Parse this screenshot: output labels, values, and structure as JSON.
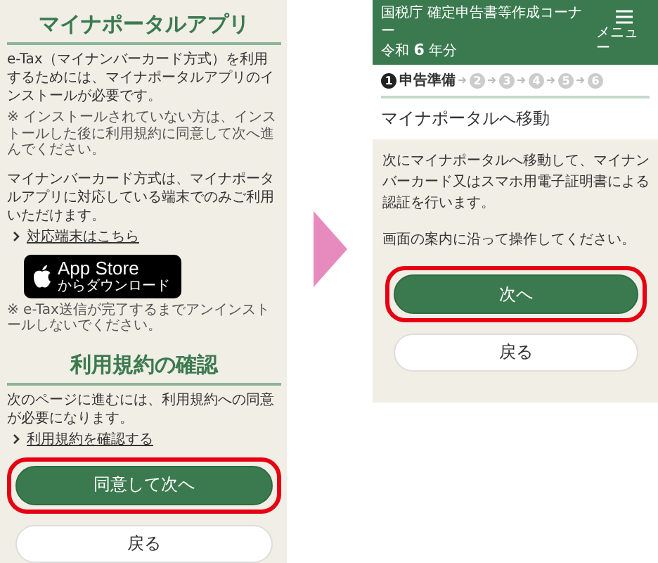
{
  "left_screen": {
    "heading": "マイナポータルアプリ",
    "intro": "e-Tax（マイナンバーカード方式）を利用するためには、マイナポータルアプリのインストールが必要です。",
    "install_note": "※ インストールされていない方は、インストールした後に利用規約に同意して次へ進んでください。",
    "support_text": "マイナンバーカード方式は、マイナポータルアプリに対応している端末でのみご利用いただけます。",
    "device_link": "対応端末はこちら",
    "app_store_badge": {
      "title": "App Store",
      "subtitle": "からダウンロード"
    },
    "uninstall_note": "※ e-Tax送信が完了するまでアンインストールしないでください。",
    "terms_heading": "利用規約の確認",
    "terms_text": "次のページに進むには、利用規約への同意が必要になります。",
    "terms_link": "利用規約を確認する",
    "buttons": [
      {
        "label": "同意して次へ",
        "kind": "primary",
        "highlighted": true
      },
      {
        "label": "戻る",
        "kind": "secondary",
        "highlighted": false
      }
    ]
  },
  "right_screen": {
    "header": {
      "title": "国税庁 確定申告書等作成コーナー",
      "year": "令和 **6** 年分",
      "menu_label": "メニュー"
    },
    "steps": [
      {
        "number": "1",
        "label": "申告準備",
        "selected": true
      },
      {
        "number": "2",
        "selected": false
      },
      {
        "number": "3",
        "selected": false
      },
      {
        "number": "4",
        "selected": false
      },
      {
        "number": "5",
        "selected": false
      },
      {
        "number": "6",
        "selected": false
      }
    ],
    "page_title": "マイナポータルへ移動",
    "paragraphs": [
      "次にマイナポータルへ移動して、マイナンバーカード又はスマホ用電子証明書による認証を行います。",
      "画面の案内に沿って操作してください。"
    ],
    "buttons": [
      {
        "label": "次へ",
        "kind": "primary",
        "highlighted": true
      },
      {
        "label": "戻る",
        "kind": "secondary",
        "highlighted": false
      }
    ]
  }
}
